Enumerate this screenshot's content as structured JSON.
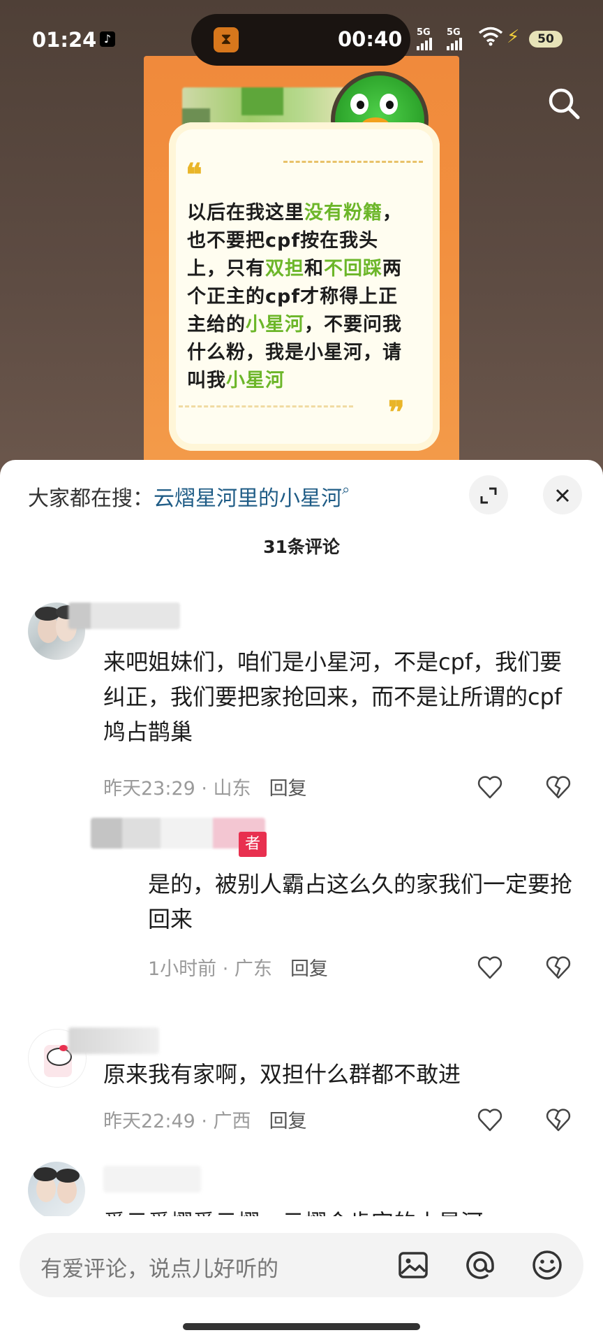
{
  "status_bar": {
    "time": "01:24",
    "timer": "00:40",
    "net1": "5G",
    "net2": "5G",
    "battery": "50"
  },
  "poster": {
    "text_parts": [
      {
        "t": "以后在我这里",
        "hl": false
      },
      {
        "t": "没有粉籍",
        "hl": true
      },
      {
        "t": "，也不要把cpf按在我头上，只有",
        "hl": false
      },
      {
        "t": "双担",
        "hl": true
      },
      {
        "t": "和",
        "hl": false
      },
      {
        "t": "不回踩",
        "hl": true
      },
      {
        "t": "两个正主的cpf才称得上正主给的",
        "hl": false
      },
      {
        "t": "小星河",
        "hl": true
      },
      {
        "t": "，不要问我什么粉，我是小星河，请叫我",
        "hl": false
      },
      {
        "t": "小星河",
        "hl": true
      }
    ]
  },
  "sheet": {
    "search_prefix": "大家都在搜：",
    "search_keyword": "云熠星河里的小星河",
    "comment_count": "31条评论"
  },
  "comments": [
    {
      "text": "来吧姐妹们，咱们是小星河，不是cpf，我们要纠正，我们要把家抢回来，而不是让所谓的cpf鸠占鹊巢",
      "meta": "昨天23:29 · 山东",
      "reply": "回复"
    },
    {
      "badge": "者",
      "text": "是的，被别人霸占这么久的家我们一定要抢回来",
      "meta": "1小时前 · 广东",
      "reply": "回复"
    },
    {
      "text": "原来我有家啊，双担什么群都不敢进",
      "meta": "昨天22:49 · 广西",
      "reply": "回复"
    },
    {
      "text": "爱云爱熠爱云熠，云熠会肯定的小星河"
    }
  ],
  "input": {
    "placeholder": "有爱评论，说点儿好听的"
  },
  "colors": {
    "accent_green": "#6cb629",
    "keyword_blue": "#1f5c86",
    "poster_orange": "#f08a3c"
  },
  "icons": [
    "search-icon",
    "expand-icon",
    "close-icon",
    "heart-icon",
    "broken-heart-icon",
    "image-icon",
    "at-icon",
    "emoji-icon"
  ]
}
